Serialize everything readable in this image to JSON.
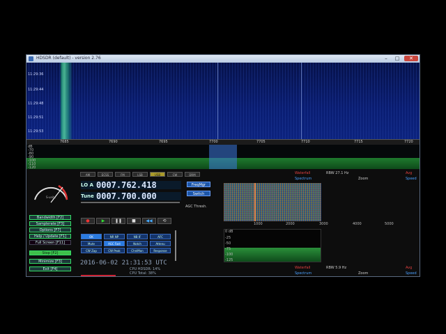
{
  "window": {
    "title": "HDSDR (default) - version 2.76",
    "minimize": "–",
    "maximize": "□",
    "close": "✕"
  },
  "waterfall": {
    "times": [
      "11:29:36",
      "11:29:44",
      "11:29:48",
      "11:29:51",
      "11:29:53"
    ]
  },
  "spectrum": {
    "freq_ticks": [
      "7685",
      "7690",
      "7695",
      "7700",
      "7705",
      "7710",
      "7715",
      "7720"
    ],
    "db_labels": [
      "dB",
      "-70",
      "-80",
      "-90",
      "-100",
      "-110",
      "-120"
    ]
  },
  "modes": [
    "AM",
    "ECSS",
    "FM",
    "LSB",
    "USB",
    "CW",
    "DRM"
  ],
  "active_mode": "USB",
  "lo": {
    "label": "LO A",
    "value": "0007.762.418"
  },
  "tune": {
    "label": "Tune",
    "value": "0007.700.000"
  },
  "freq_mgr": "FreqMgr",
  "switch_btn": "Switch",
  "agc_thresh": "AGC Thresh.",
  "smeter_label": "S-units",
  "left_buttons": [
    {
      "label": "Bandwidth [F2]"
    },
    {
      "label": "Samplerate [F3]"
    },
    {
      "label": "Options [F7]"
    },
    {
      "label": "Help / Update [F1]"
    },
    {
      "label": "Full Screen [F11]"
    }
  ],
  "stop_btn": "Stop [F2]",
  "minimize_btn": "Minimize [F3]",
  "exit_btn": "Exit [F4]",
  "agc_buttons": [
    "OK",
    "NR NP",
    "NB IF",
    "AFC",
    "Mute",
    "AGC Fast",
    "Notch",
    "Attenu",
    "CW Zap",
    "CW Peak",
    "ChnlMon",
    "Response"
  ],
  "datetime": "2016-06-02  21:31:53 UTC",
  "cpu": {
    "hdsdr": "CPU HDSDR: 14%",
    "total": "CPU Total: 38%"
  },
  "rf": {
    "waterfall": "Waterfall",
    "rbw": "RBW 27.1 Hz",
    "avg": "Avg",
    "spectrum": "Spectrum",
    "zoom": "Zoom",
    "speed": "Speed"
  },
  "af": {
    "waterfall": "Waterfall",
    "rbw": "RBW 5.9 Hz",
    "avg": "Avg",
    "spectrum": "Spectrum",
    "zoom": "Zoom",
    "speed": "Speed"
  },
  "af_axis": [
    "1000",
    "2000",
    "3000",
    "4000",
    "5000"
  ],
  "af_db": [
    "0 dB",
    "-25",
    "-50",
    "-75",
    "-100",
    "-125"
  ]
}
